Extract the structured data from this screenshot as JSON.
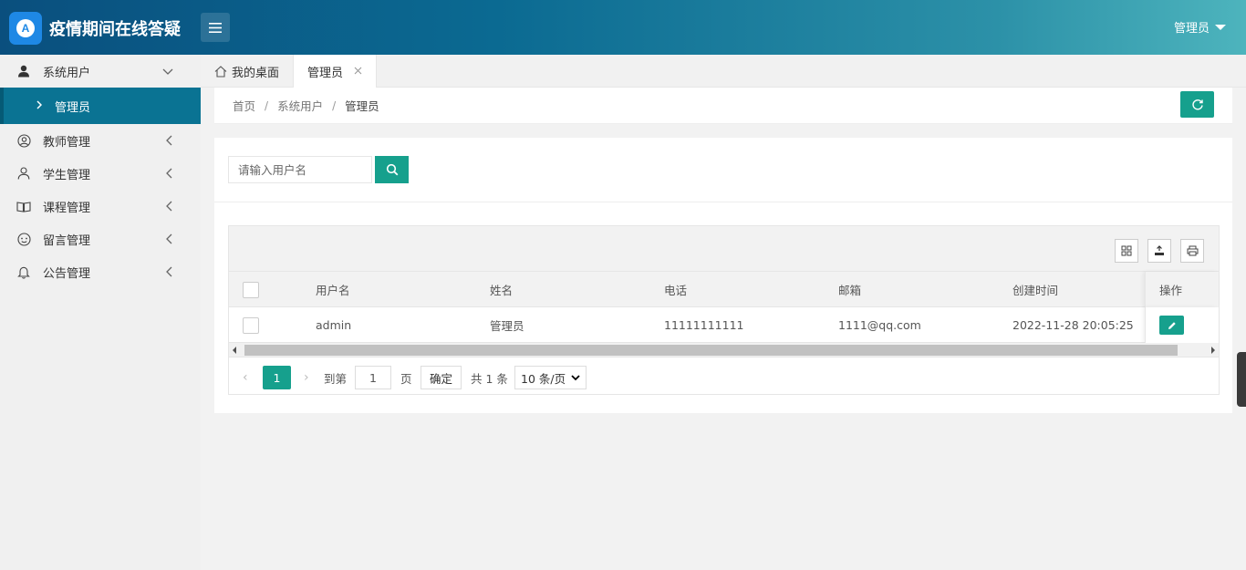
{
  "header": {
    "logo_letter": "A",
    "title": "疫情期间在线答疑",
    "user": "管理员"
  },
  "sidebar": {
    "items": [
      {
        "label": "系统用户",
        "icon": "user-solid-icon",
        "expanded": true
      },
      {
        "label": "教师管理",
        "icon": "user-circle-icon"
      },
      {
        "label": "学生管理",
        "icon": "user-outline-icon"
      },
      {
        "label": "课程管理",
        "icon": "book-icon"
      },
      {
        "label": "留言管理",
        "icon": "smile-icon"
      },
      {
        "label": "公告管理",
        "icon": "bell-icon"
      }
    ],
    "sub_items": [
      {
        "label": "管理员",
        "active": true
      }
    ]
  },
  "tabs": [
    {
      "label": "我的桌面",
      "icon": "home-icon"
    },
    {
      "label": "管理员",
      "active": true
    }
  ],
  "breadcrumb": [
    "首页",
    "系统用户",
    "管理员"
  ],
  "search": {
    "placeholder": "请输入用户名"
  },
  "table": {
    "columns": [
      "用户名",
      "姓名",
      "电话",
      "邮箱",
      "创建时间",
      "操作"
    ],
    "rows": [
      {
        "username": "admin",
        "name": "管理员",
        "phone": "11111111111",
        "email": "1111@qq.com",
        "created": "2022-11-28 20:05:25"
      }
    ]
  },
  "pagination": {
    "current": "1",
    "goto_label": "到第",
    "goto_value": "1",
    "page_label": "页",
    "confirm": "确定",
    "total": "共 1 条",
    "page_size": "10 条/页"
  },
  "colors": {
    "accent": "#16a08d",
    "sidebar_active": "#0a7393"
  }
}
